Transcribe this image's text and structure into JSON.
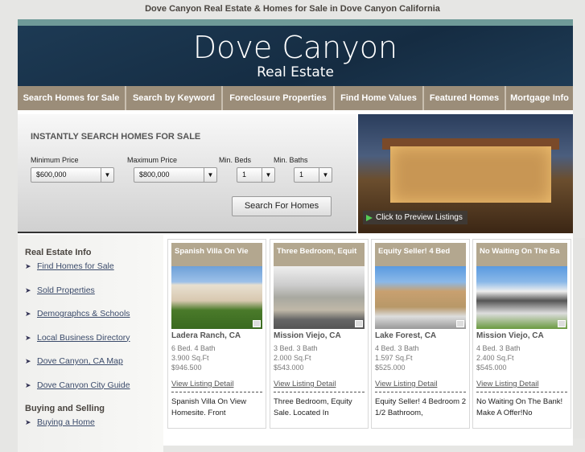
{
  "page_title": "Dove Canyon Real Estate & Homes for Sale in Dove Canyon California",
  "banner": {
    "title": "Dove Canyon",
    "subtitle": "Real Estate"
  },
  "nav": [
    "Search Homes for Sale",
    "Search by Keyword",
    "Foreclosure Properties",
    "Find Home Values",
    "Featured Homes",
    "Mortgage Info"
  ],
  "search": {
    "heading": "INSTANTLY SEARCH HOMES FOR SALE",
    "min_price_label": "Minimum Price",
    "min_price": "$600,000",
    "max_price_label": "Maximum Price",
    "max_price": "$800,000",
    "beds_label": "Min. Beds",
    "beds": "1",
    "baths_label": "Min. Baths",
    "baths": "1",
    "button": "Search For Homes"
  },
  "hero": {
    "cta": "Click to Preview Listings"
  },
  "sidebar": {
    "heading1": "Real Estate Info",
    "links": [
      "Find Homes for Sale",
      "Sold Properties",
      "Demographcs & Schools",
      "Local Business Directory",
      "Dove Canyon, CA Map",
      "Dove Canyon City Guide"
    ],
    "heading2": "Buying and Selling",
    "links2": [
      "Buying a Home"
    ]
  },
  "listings": [
    {
      "title": "Spanish Villa On Vie",
      "city": "Ladera Ranch, CA",
      "beds": "6 Bed. 4 Bath",
      "sqft": "3.900 Sq.Ft",
      "price": "$946.500",
      "link": "View Listing Detail",
      "desc": "Spanish Villa On View Homesite. Front"
    },
    {
      "title": "Three Bedroom, Equit",
      "city": "Mission Viejo, CA",
      "beds": "3 Bed. 3 Bath",
      "sqft": "2.000 Sq.Ft",
      "price": "$543.000",
      "link": "View Listing Detail",
      "desc": "Three Bedroom, Equity Sale. Located In"
    },
    {
      "title": "Equity Seller! 4 Bed",
      "city": "Lake Forest, CA",
      "beds": "4 Bed. 3 Bath",
      "sqft": "1.597 Sq.Ft",
      "price": "$525.000",
      "link": "View Listing Detail",
      "desc": "Equity Seller! 4 Bedroom 2 1/2 Bathroom,"
    },
    {
      "title": "No Waiting On The Ba",
      "city": "Mission Viejo, CA",
      "beds": "4 Bed. 3 Bath",
      "sqft": "2.400 Sq.Ft",
      "price": "$545.000",
      "link": "View Listing Detail",
      "desc": "No Waiting On The Bank! Make A Offer!No"
    }
  ]
}
